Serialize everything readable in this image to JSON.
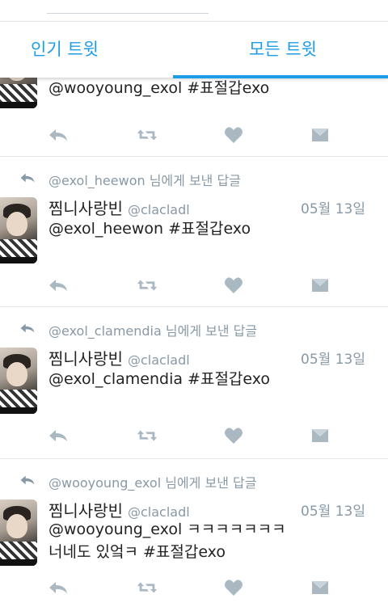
{
  "tabs": {
    "popular": "인기 트윗",
    "all": "모든 트윗"
  },
  "partial_tweet": {
    "text": "@wooyoung_exol #표절갑exo"
  },
  "tweets": [
    {
      "reply_to_handle": "@exol_heewon",
      "reply_suffix": " 님에게 보낸 답글",
      "name": "찜니사랑빈",
      "username": "@clacladl",
      "date": "05월 13일",
      "text_line1": "@exol_heewon #표절갑exo",
      "text_line2": ""
    },
    {
      "reply_to_handle": "@exol_clamendia",
      "reply_suffix": " 님에게 보낸 답글",
      "name": "찜니사랑빈",
      "username": "@clacladl",
      "date": "05월 13일",
      "text_line1": "@exol_clamendia #표절갑exo",
      "text_line2": ""
    },
    {
      "reply_to_handle": "@wooyoung_exol",
      "reply_suffix": " 님에게 보낸 답글",
      "name": "찜니사랑빈",
      "username": "@clacladl",
      "date": "05월 13일",
      "text_line1": "@wooyoung_exol ㅋㅋㅋㅋㅋㅋㅋ",
      "text_line2": "너네도 있엌ㅋ #표절갑exo"
    }
  ],
  "icons": {
    "reply": "reply-icon",
    "retweet": "retweet-icon",
    "like": "heart-icon",
    "dm": "direct-message-icon"
  },
  "colors": {
    "accent": "#1d9ce7",
    "muted": "#8899a6",
    "icon": "#aab8c2"
  }
}
